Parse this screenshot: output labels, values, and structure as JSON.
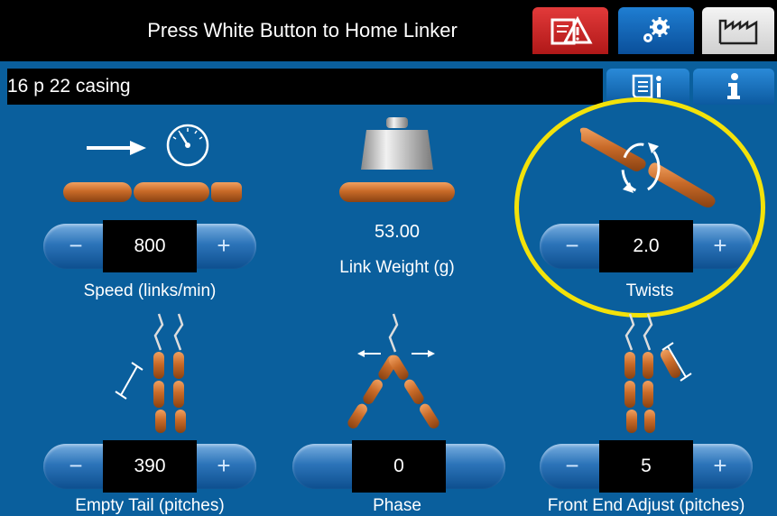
{
  "header": {
    "status_message": "Press White Button to Home Linker",
    "buttons": [
      {
        "name": "alarm",
        "icon": "alarm-warning-icon",
        "color": "#d42626"
      },
      {
        "name": "settings",
        "icon": "gears-icon",
        "color": "#1468c0"
      },
      {
        "name": "production",
        "icon": "factory-icon",
        "color": "#e6e6e6"
      }
    ]
  },
  "recipe": {
    "name": "16 p 22 casing",
    "recipe_info_icon": "recipe-document-icon",
    "info_icon": "info-icon"
  },
  "controls": {
    "speed": {
      "label": "Speed (links/min)",
      "value": "800",
      "minus": "−",
      "plus": "+",
      "icon": "speedometer-icon"
    },
    "link_weight": {
      "label": "Link Weight (g)",
      "value": "53.00",
      "icon": "weight-icon"
    },
    "twists": {
      "label": "Twists",
      "value": "2.0",
      "minus": "−",
      "plus": "+",
      "icon": "twist-rotation-icon"
    },
    "empty_tail": {
      "label": "Empty Tail (pitches)",
      "value": "390",
      "minus": "−",
      "plus": "+",
      "icon": "empty-tail-icon"
    },
    "phase": {
      "label": "Phase",
      "value": "0",
      "icon": "phase-icon"
    },
    "front_end_adjust": {
      "label": "Front End Adjust (pitches)",
      "value": "5",
      "minus": "−",
      "plus": "+",
      "icon": "front-end-adjust-icon"
    }
  },
  "colors": {
    "background": "#0a5f9d",
    "highlight": "#f3e20a",
    "sausage": "#c86a28"
  }
}
